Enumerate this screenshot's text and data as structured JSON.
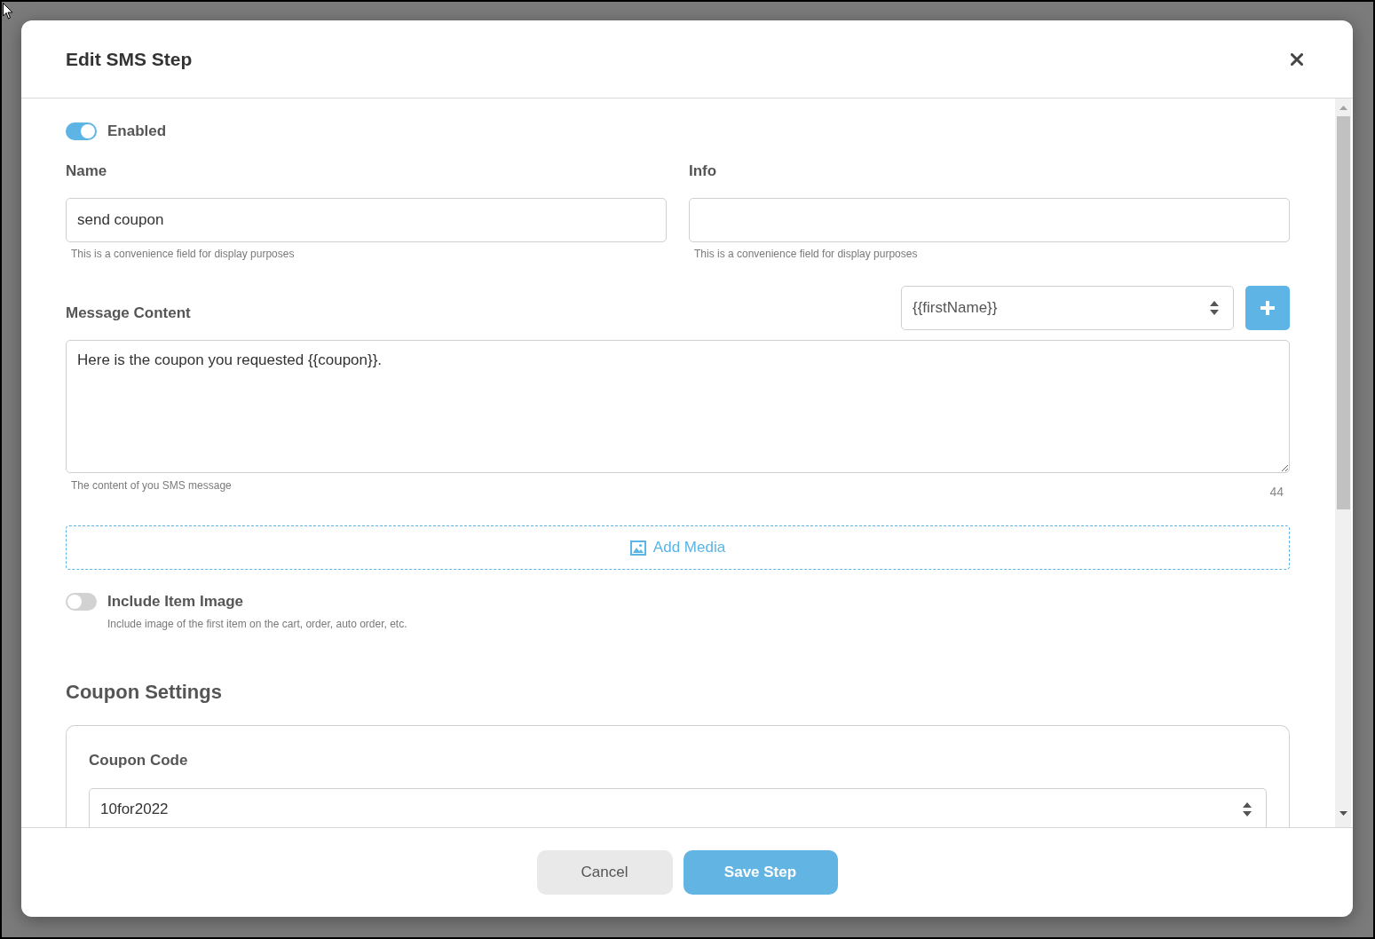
{
  "dialog": {
    "title": "Edit SMS Step"
  },
  "enabled_toggle": {
    "label": "Enabled",
    "on": true
  },
  "fields": [
    {
      "label": "Name",
      "value": "send coupon",
      "help": "This is a convenience field for display purposes"
    },
    {
      "label": "Info",
      "help": "This is a convenience field for display purposes"
    }
  ],
  "message": {
    "label": "Message Content",
    "merge_field_select": {
      "value": "{{firstName}}"
    },
    "content": "Here is the coupon you requested {{coupon}}.",
    "help": "The content of you SMS message",
    "char_count": "44"
  },
  "add_media": {
    "label": "Add Media"
  },
  "include_item_image": {
    "label": "Include Item Image",
    "on": false,
    "description": "Include image of the first item on the cart, order, auto order, etc."
  },
  "coupon_settings": {
    "heading": "Coupon Settings",
    "coupon_code": {
      "label": "Coupon Code",
      "value": "10for2022"
    }
  },
  "footer": {
    "buttons": [
      {
        "label": "Cancel",
        "kind": "secondary"
      },
      {
        "label": "Save Step",
        "kind": "primary"
      }
    ]
  }
}
